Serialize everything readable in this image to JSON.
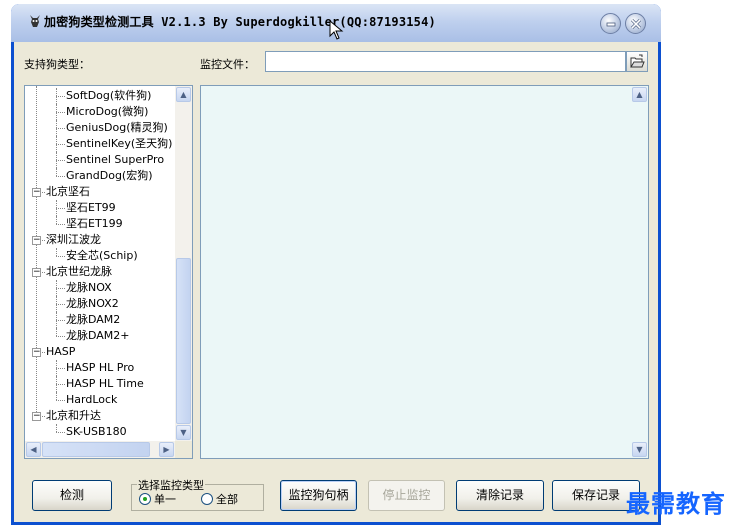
{
  "title_bar": {
    "title": "加密狗类型检测工具 V2.1.3 By Superdogkiller(QQ:87193154)"
  },
  "labels": {
    "supported_types": "支持狗类型：",
    "monitor_file": "监控文件："
  },
  "monitor_file_input": {
    "value": ""
  },
  "tree": {
    "items": [
      {
        "label": "SoftDog(软件狗)",
        "level": 1
      },
      {
        "label": "MicroDog(微狗)",
        "level": 1
      },
      {
        "label": "GeniusDog(精灵狗)",
        "level": 1
      },
      {
        "label": "SentinelKey(圣天狗)",
        "level": 1
      },
      {
        "label": "Sentinel SuperPro",
        "level": 1
      },
      {
        "label": "GrandDog(宏狗)",
        "level": 1
      },
      {
        "label": "北京坚石",
        "level": 0
      },
      {
        "label": "坚石ET99",
        "level": 1
      },
      {
        "label": "坚石ET199",
        "level": 1
      },
      {
        "label": "深圳江波龙",
        "level": 0
      },
      {
        "label": "安全芯(Schip)",
        "level": 1
      },
      {
        "label": "北京世纪龙脉",
        "level": 0
      },
      {
        "label": "龙脉NOX",
        "level": 1
      },
      {
        "label": "龙脉NOX2",
        "level": 1
      },
      {
        "label": "龙脉DAM2",
        "level": 1
      },
      {
        "label": "龙脉DAM2+",
        "level": 1
      },
      {
        "label": "HASP",
        "level": 0
      },
      {
        "label": "HASP HL Pro",
        "level": 1
      },
      {
        "label": "HASP HL Time",
        "level": 1
      },
      {
        "label": "HardLock",
        "level": 1
      },
      {
        "label": "北京和升达",
        "level": 0
      },
      {
        "label": "SK-USB180",
        "level": 1
      }
    ]
  },
  "buttons": {
    "detect": "检测",
    "monitor_handle": "监控狗句柄",
    "stop_monitor": "停止监控",
    "clear_log": "清除记录",
    "save_log": "保存记录"
  },
  "monitor_type_group": {
    "title": "选择监控类型",
    "options": [
      {
        "label": "单一",
        "selected": true
      },
      {
        "label": "全部",
        "selected": false
      }
    ]
  },
  "watermark": "最需教育",
  "colors": {
    "title_bar": "#bfd0ee",
    "window_frame": "#0c50d0",
    "client_bg": "#ece9d8",
    "log_bg": "#ebf7f7",
    "watermark": "#1565ff"
  }
}
